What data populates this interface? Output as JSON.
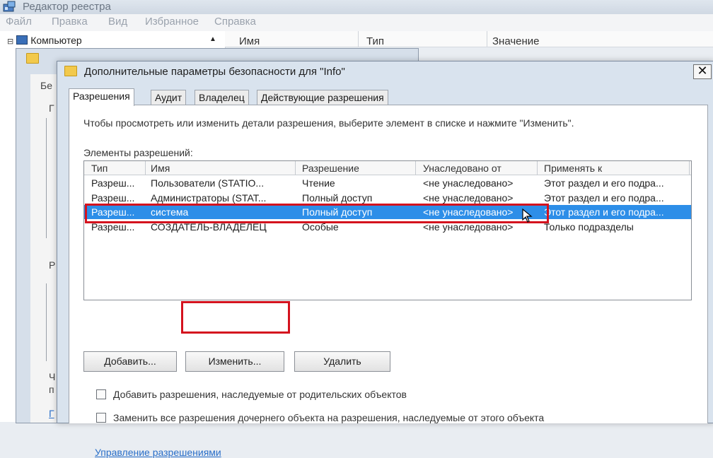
{
  "app": {
    "title": "Редактор реестра",
    "menu": [
      "Файл",
      "Правка",
      "Вид",
      "Избранное",
      "Справка"
    ],
    "tree_root": "Компьютер",
    "columns": [
      "Имя",
      "Тип",
      "Значение"
    ]
  },
  "bg_dialog": {
    "fragments": [
      "Бе",
      "Г",
      "Р",
      "Ч",
      "п",
      "Г"
    ]
  },
  "dialog": {
    "title": "Дополнительные параметры безопасности для \"Info\"",
    "close_label": "✕",
    "tabs": [
      "Разрешения",
      "Аудит",
      "Владелец",
      "Действующие разрешения"
    ],
    "active_tab": 0,
    "instructions": "Чтобы просмотреть или изменить детали разрешения, выберите элемент в списке и нажмите \"Изменить\".",
    "entries_label": "Элементы разрешений:",
    "columns": [
      "Тип",
      "Имя",
      "Разрешение",
      "Унаследовано от",
      "Применять к"
    ],
    "rows": [
      {
        "type": "Разреш...",
        "name": "Пользователи (STATIO...",
        "permission": "Чтение",
        "inherited": "<не унаследовано>",
        "apply": "Этот раздел и его подра..."
      },
      {
        "type": "Разреш...",
        "name": "Администраторы (STAT...",
        "permission": "Полный доступ",
        "inherited": "<не унаследовано>",
        "apply": "Этот раздел и его подра..."
      },
      {
        "type": "Разреш...",
        "name": "система",
        "permission": "Полный доступ",
        "inherited": "<не унаследовано>",
        "apply": "Этот раздел и его подра..."
      },
      {
        "type": "Разреш...",
        "name": "СОЗДАТЕЛЬ-ВЛАДЕЛЕЦ",
        "permission": "Особые",
        "inherited": "<не унаследовано>",
        "apply": "Только подразделы"
      }
    ],
    "selected_row": 2,
    "buttons": {
      "add": "Добавить...",
      "edit": "Изменить...",
      "remove": "Удалить"
    },
    "checkbox_inherit": "Добавить разрешения, наследуемые от родительских объектов",
    "checkbox_replace": "Заменить все разрешения дочернего объекта на разрешения, наследуемые от этого объекта",
    "link": "Управление разрешениями"
  },
  "colors": {
    "selection": "#2d8ee8",
    "highlight_outline": "#d4121e",
    "link": "#2a6fc9"
  }
}
